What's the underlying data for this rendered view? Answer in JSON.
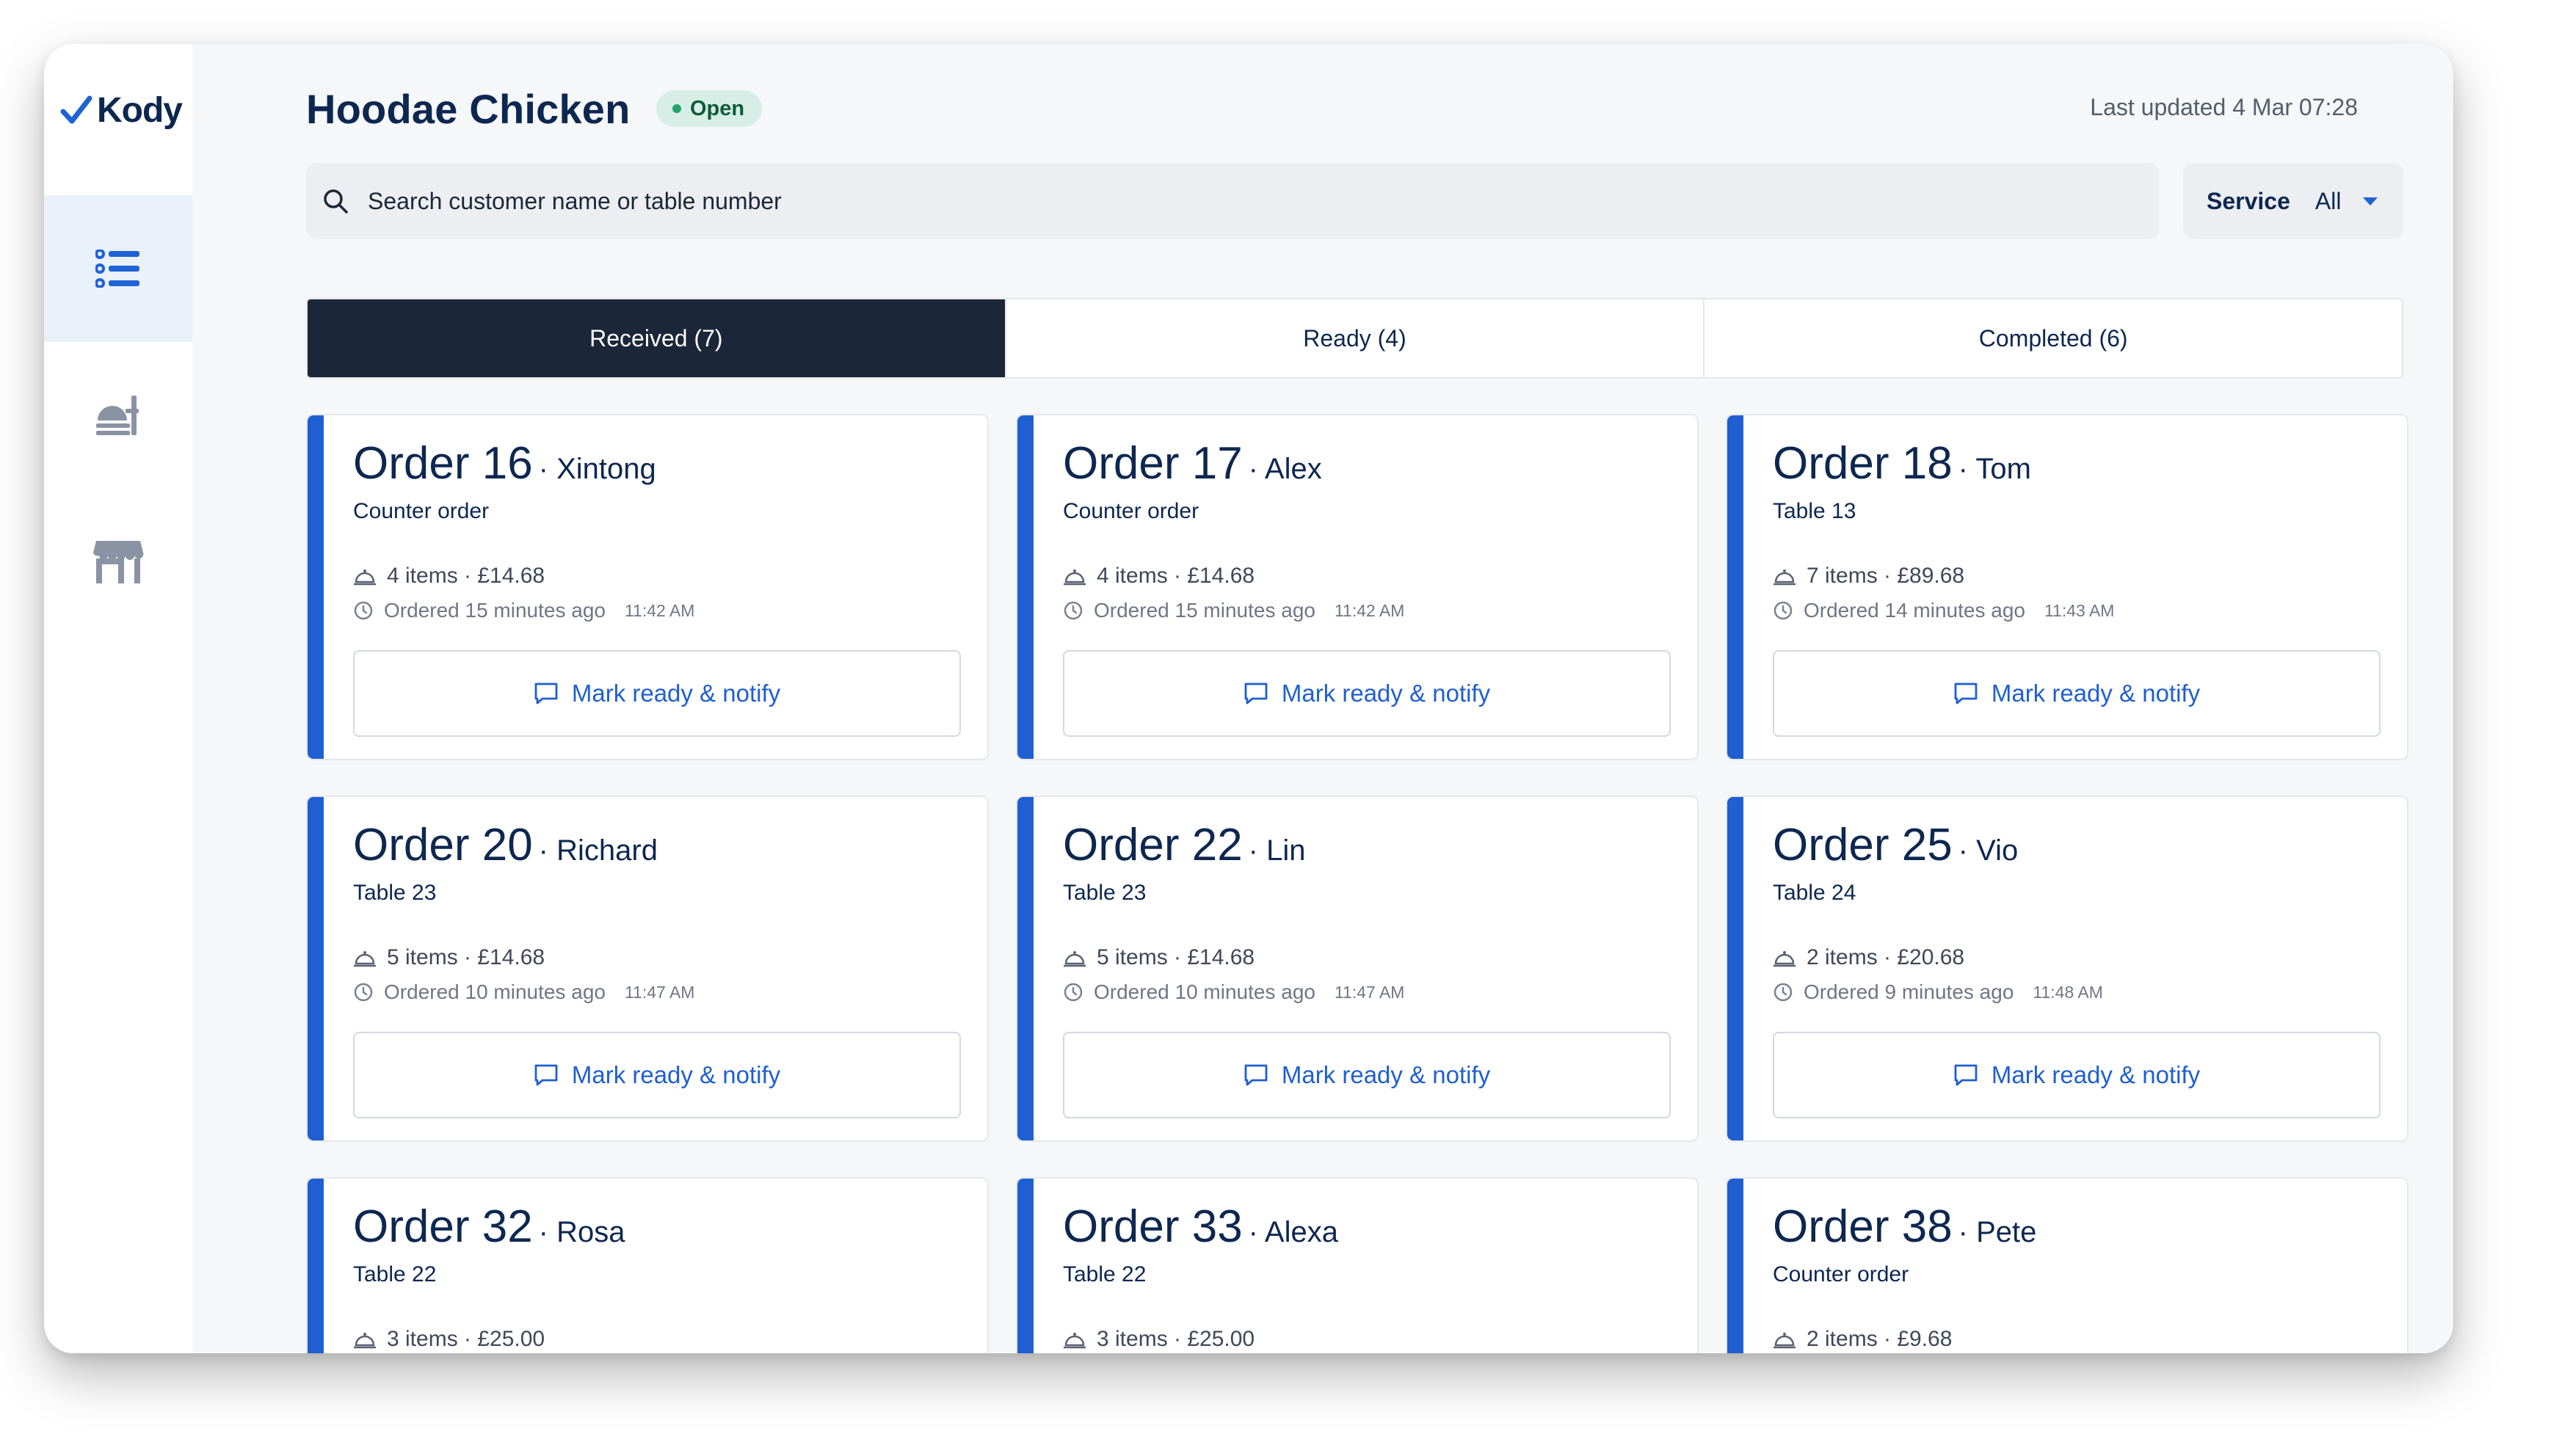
{
  "app": {
    "logo_text": "Kody"
  },
  "header": {
    "title": "Hoodae Chicken",
    "status": "Open",
    "last_updated": "Last updated 4 Mar 07:28"
  },
  "search": {
    "placeholder": "Search customer name or table number"
  },
  "service": {
    "label": "Service",
    "value": "All"
  },
  "tabs": [
    {
      "label": "Received (7)",
      "active": true
    },
    {
      "label": "Ready (4)",
      "active": false
    },
    {
      "label": "Completed (6)",
      "active": false
    }
  ],
  "orders": [
    {
      "order": "Order 16",
      "name": "· Xintong",
      "type": "Counter order",
      "items": "4 items · £14.68",
      "ordered": "Ordered 15 minutes ago",
      "time": "11:42 AM",
      "action": "Mark ready & notify"
    },
    {
      "order": "Order 17",
      "name": "· Alex",
      "type": "Counter order",
      "items": "4 items · £14.68",
      "ordered": "Ordered 15 minutes ago",
      "time": "11:42 AM",
      "action": "Mark ready & notify"
    },
    {
      "order": "Order 18",
      "name": "· Tom",
      "type": "Table 13",
      "items": "7 items · £89.68",
      "ordered": "Ordered 14 minutes ago",
      "time": "11:43 AM",
      "action": "Mark ready & notify"
    },
    {
      "order": "Order 20",
      "name": "· Richard",
      "type": "Table 23",
      "items": "5 items · £14.68",
      "ordered": "Ordered 10 minutes ago",
      "time": "11:47 AM",
      "action": "Mark ready & notify"
    },
    {
      "order": "Order 22",
      "name": "· Lin",
      "type": "Table 23",
      "items": "5 items · £14.68",
      "ordered": "Ordered 10 minutes ago",
      "time": "11:47 AM",
      "action": "Mark ready & notify"
    },
    {
      "order": "Order 25",
      "name": "· Vio",
      "type": "Table 24",
      "items": "2 items · £20.68",
      "ordered": "Ordered 9 minutes ago",
      "time": "11:48 AM",
      "action": "Mark ready & notify"
    },
    {
      "order": "Order 32",
      "name": "· Rosa",
      "type": "Table 22",
      "items": "3 items · £25.00"
    },
    {
      "order": "Order 33",
      "name": "· Alexa",
      "type": "Table 22",
      "items": "3 items · £25.00"
    },
    {
      "order": "Order 38",
      "name": "· Pete",
      "type": "Counter order",
      "items": "2 items · £9.68"
    }
  ],
  "colors": {
    "accent": "#1f5fd1",
    "navy": "#0d2750",
    "active_tab": "#1b2638",
    "open_badge": "#d7eee6"
  }
}
